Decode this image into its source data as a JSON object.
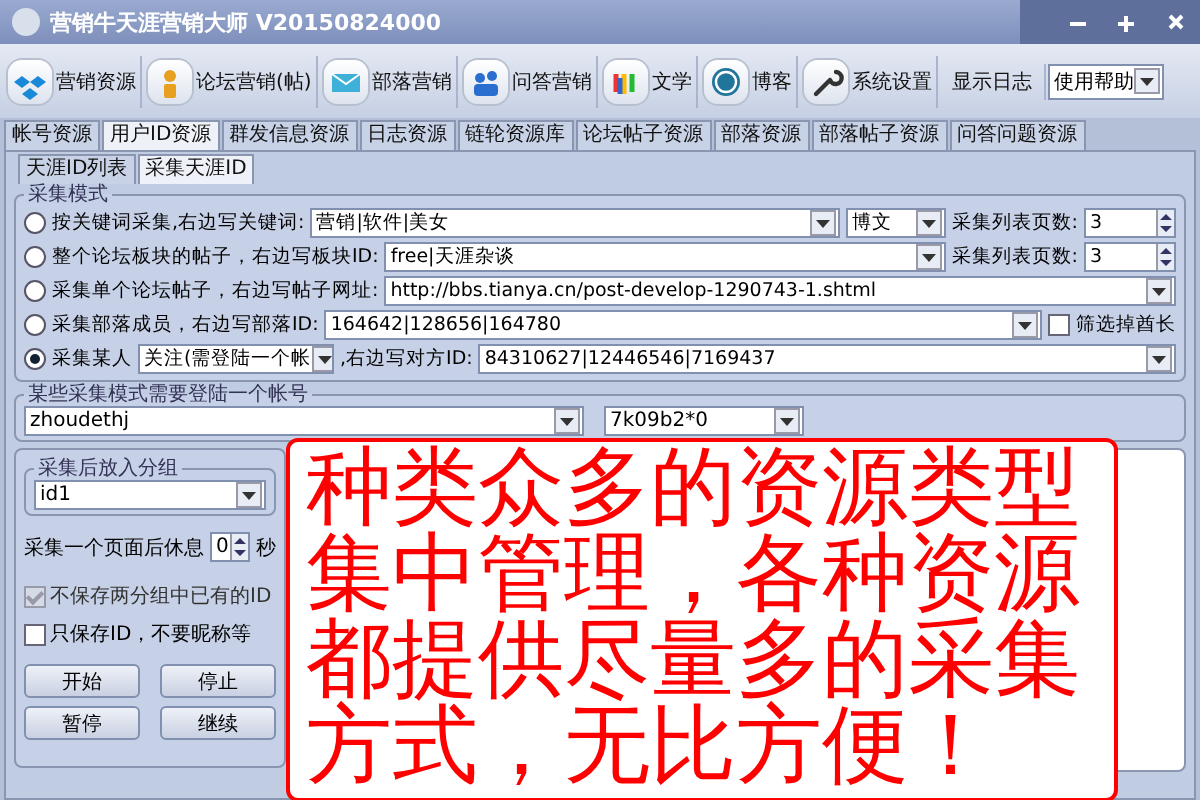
{
  "window": {
    "title": "营销牛天涯营销大师 V20150824000"
  },
  "toolbar": [
    {
      "kind": "icon-button",
      "label": "营销资源"
    },
    {
      "kind": "icon-button",
      "label": "论坛营销(帖)"
    },
    {
      "kind": "icon-button",
      "label": "部落营销"
    },
    {
      "kind": "icon-button",
      "label": "问答营销"
    },
    {
      "kind": "icon-button",
      "label": "文学"
    },
    {
      "kind": "icon-button",
      "label": "博客"
    },
    {
      "kind": "icon-button",
      "label": "系统设置"
    },
    {
      "kind": "text-button",
      "label": "显示日志"
    },
    {
      "kind": "dropdown",
      "label": "使用帮助"
    }
  ],
  "tabs": [
    {
      "label": "帐号资源",
      "selected": false
    },
    {
      "label": "用户ID资源",
      "selected": true
    },
    {
      "label": "群发信息资源",
      "selected": false
    },
    {
      "label": "日志资源",
      "selected": false
    },
    {
      "label": "链轮资源库",
      "selected": false
    },
    {
      "label": "论坛帖子资源",
      "selected": false
    },
    {
      "label": "部落资源",
      "selected": false
    },
    {
      "label": "部落帖子资源",
      "selected": false
    },
    {
      "label": "问答问题资源",
      "selected": false
    }
  ],
  "subtabs": [
    {
      "label": "天涯ID列表",
      "selected": false
    },
    {
      "label": "采集天涯ID",
      "selected": true
    }
  ],
  "mode_group": {
    "title": "采集模式",
    "rows": [
      {
        "label": "按关键词采集,右边写关键词:",
        "selected": false,
        "value": "营销|软件|美女",
        "select": "博文",
        "pages_label": "采集列表页数:",
        "pages": "3"
      },
      {
        "label": "整个论坛板块的帖子，右边写板块ID:",
        "selected": false,
        "value": "free|天涯杂谈",
        "pages_label": "采集列表页数:",
        "pages": "3"
      },
      {
        "label": "采集单个论坛帖子，右边写帖子网址:",
        "selected": false,
        "value": "http://bbs.tianya.cn/post-develop-1290743-1.shtml"
      },
      {
        "label": "采集部落成员，右边写部落ID:",
        "selected": false,
        "value": "164642|128656|164780",
        "checkbox": {
          "label": "筛选掉酋长",
          "checked": false
        }
      },
      {
        "label": "采集某人",
        "selected": true,
        "combo": "关注(需登陆一个帐",
        "label_2": ",右边写对方ID:",
        "value": "84310627|12446546|7169437"
      }
    ]
  },
  "login_group": {
    "title": "某些采集模式需要登陆一个帐号",
    "account": "zhoudethj",
    "field_2": "7k09b2*0"
  },
  "group_group": {
    "title": "采集后放入分组",
    "value": "id1"
  },
  "pause": {
    "label": "采集一个页面后休息",
    "value": "0",
    "unit": "秒"
  },
  "options": [
    {
      "label": "不保存两分组中已有的ID",
      "checked": true,
      "disabled": true
    },
    {
      "label": "只保存ID，不要昵称等",
      "checked": false,
      "disabled": false
    }
  ],
  "buttons": [
    "开始",
    "停止",
    "暂停",
    "继续"
  ],
  "overlay": {
    "lines": [
      "种类众多的资源类型",
      "集中管理，各种资源",
      "都提供尽量多的采集",
      "方式，无比方便！"
    ]
  }
}
